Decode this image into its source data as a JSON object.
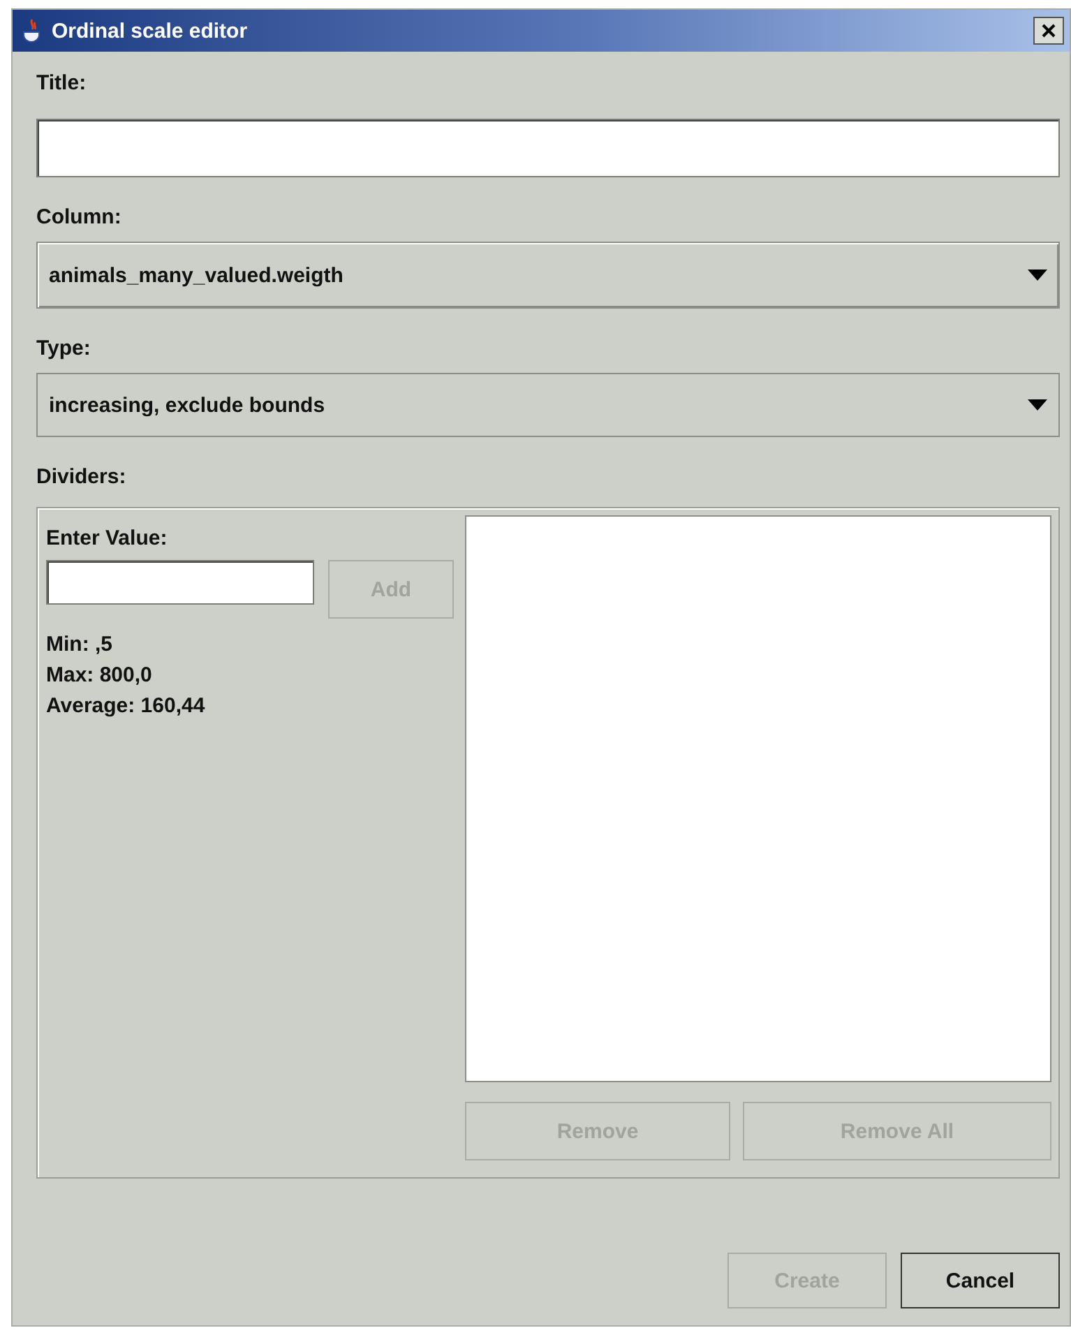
{
  "window": {
    "title": "Ordinal scale editor"
  },
  "title_field": {
    "label": "Title:"
  },
  "column": {
    "label": "Column:",
    "value": "animals_many_valued.weigth"
  },
  "type": {
    "label": "Type:",
    "value": "increasing, exclude bounds"
  },
  "dividers": {
    "label": "Dividers:",
    "enter_label": "Enter Value:",
    "add_button": {
      "label": "Add",
      "disabled": true
    },
    "stats": [
      "Min: ,5",
      "Max: 800,0",
      "Average: 160,44"
    ],
    "list_buttons": [
      {
        "label": "Remove",
        "disabled": true
      },
      {
        "label": "Remove All",
        "disabled": true
      }
    ]
  },
  "buttons": [
    {
      "label": "Create",
      "disabled": true
    },
    {
      "label": "Cancel",
      "disabled": false
    }
  ]
}
